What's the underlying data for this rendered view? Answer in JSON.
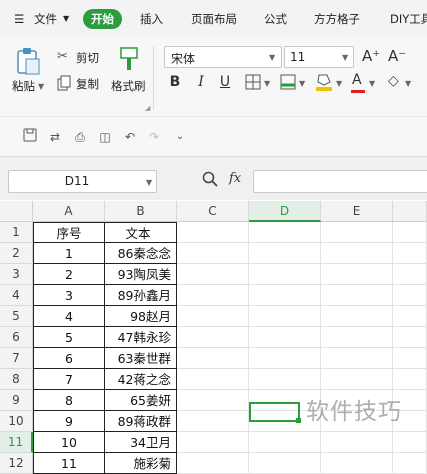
{
  "menubar": {
    "items": [
      "文件",
      "开始",
      "插入",
      "页面布局",
      "公式",
      "方方格子",
      "DIY工具"
    ]
  },
  "ribbon": {
    "paste_label": "粘贴",
    "cut_label": "剪切",
    "copy_label": "复制",
    "format_painter_label": "格式刷",
    "font_name": "宋体",
    "font_size": "11",
    "bold": "B",
    "italic": "I",
    "underline": "U",
    "font_color": "A",
    "grow_font": "A⁺",
    "shrink_font": "A⁻"
  },
  "formula": {
    "name_box": "D11",
    "fx_label": "fx",
    "content": ""
  },
  "grid": {
    "columns": [
      "A",
      "B",
      "C",
      "D",
      "E"
    ],
    "rows": [
      {
        "n": "1",
        "a": "序号",
        "b": "文本"
      },
      {
        "n": "2",
        "a": "1",
        "b": "86秦念念"
      },
      {
        "n": "3",
        "a": "2",
        "b": "93陶凤美"
      },
      {
        "n": "4",
        "a": "3",
        "b": "89孙鑫月"
      },
      {
        "n": "5",
        "a": "4",
        "b": "98赵月"
      },
      {
        "n": "6",
        "a": "5",
        "b": "47韩永珍"
      },
      {
        "n": "7",
        "a": "6",
        "b": "63秦世群"
      },
      {
        "n": "8",
        "a": "7",
        "b": "42蒋之念"
      },
      {
        "n": "9",
        "a": "8",
        "b": "65姜妍"
      },
      {
        "n": "10",
        "a": "9",
        "b": "89蒋政群"
      },
      {
        "n": "11",
        "a": "10",
        "b": "34卫月"
      },
      {
        "n": "12",
        "a": "11",
        "b": "施彩菊"
      }
    ]
  },
  "selection": {
    "cell": "D11",
    "color": "#2c9c3e"
  },
  "watermark": "软件技巧",
  "colors": {
    "accent": "#2c9c3e",
    "menubar": "#f3f3f3",
    "ribbon": "#f7f7f7"
  }
}
